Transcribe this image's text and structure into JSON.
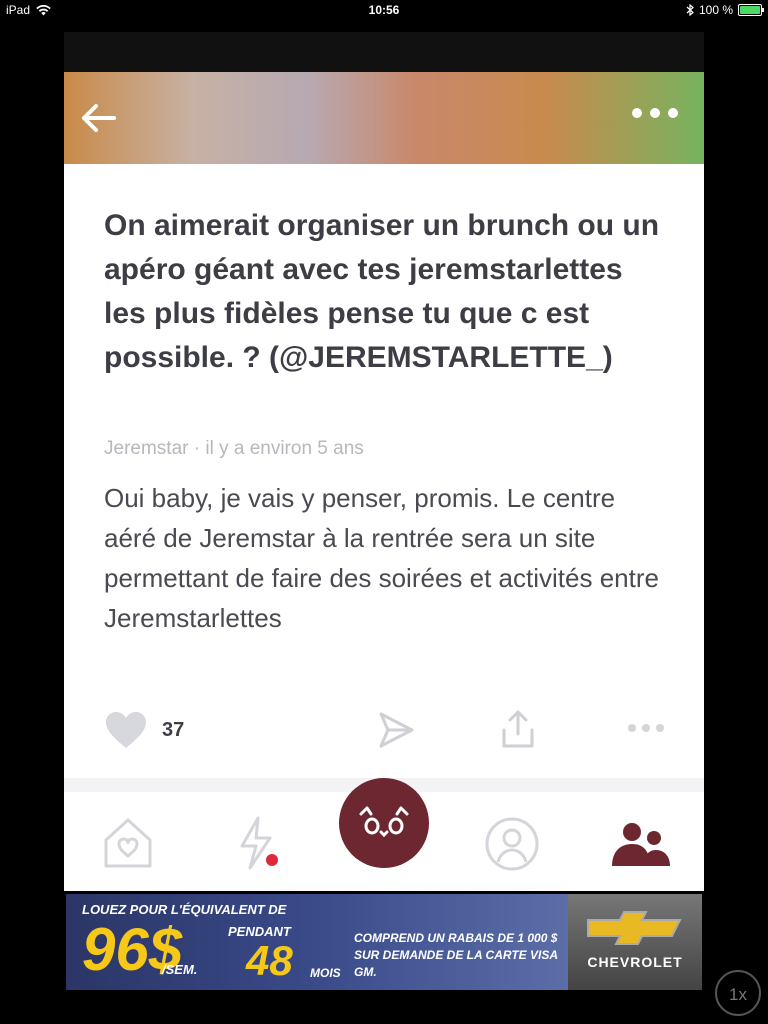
{
  "status_bar": {
    "device": "iPad",
    "time": "10:56",
    "battery_percent": "100 %"
  },
  "header": {
    "back_icon": "arrow-left-icon",
    "more_icon": "ellipsis-icon"
  },
  "post": {
    "question": "On aimerait organiser un brunch ou un apéro géant avec tes jeremstarlettes les plus fidèles pense tu que c est possible. ? (@JEREMSTARLETTE_)",
    "meta": "Jeremstar · il y a environ 5 ans",
    "answer": "Oui baby, je vais y penser, promis. Le centre aéré de Jeremstar à la rentrée sera un site permettant de faire des soirées et activités entre Jeremstarlettes",
    "like_count": "37"
  },
  "tabbar": {
    "tabs": [
      "home",
      "activity",
      "ask",
      "profile",
      "friends"
    ],
    "active_tab": "friends",
    "accent_color": "#6d2731",
    "notification_color": "#e0283c"
  },
  "ad": {
    "line1": "LOUEZ POUR L'ÉQUIVALENT DE",
    "price": "96$",
    "per_week": "/SEM.",
    "pendant": "PENDANT",
    "months_number": "48",
    "months_label": "MOIS",
    "offer": "COMPREND UN RABAIS DE 1 000 $ SUR DEMANDE DE LA CARTE VISA GM.",
    "brand": "CHEVROLET"
  },
  "zoom_label": "1x"
}
